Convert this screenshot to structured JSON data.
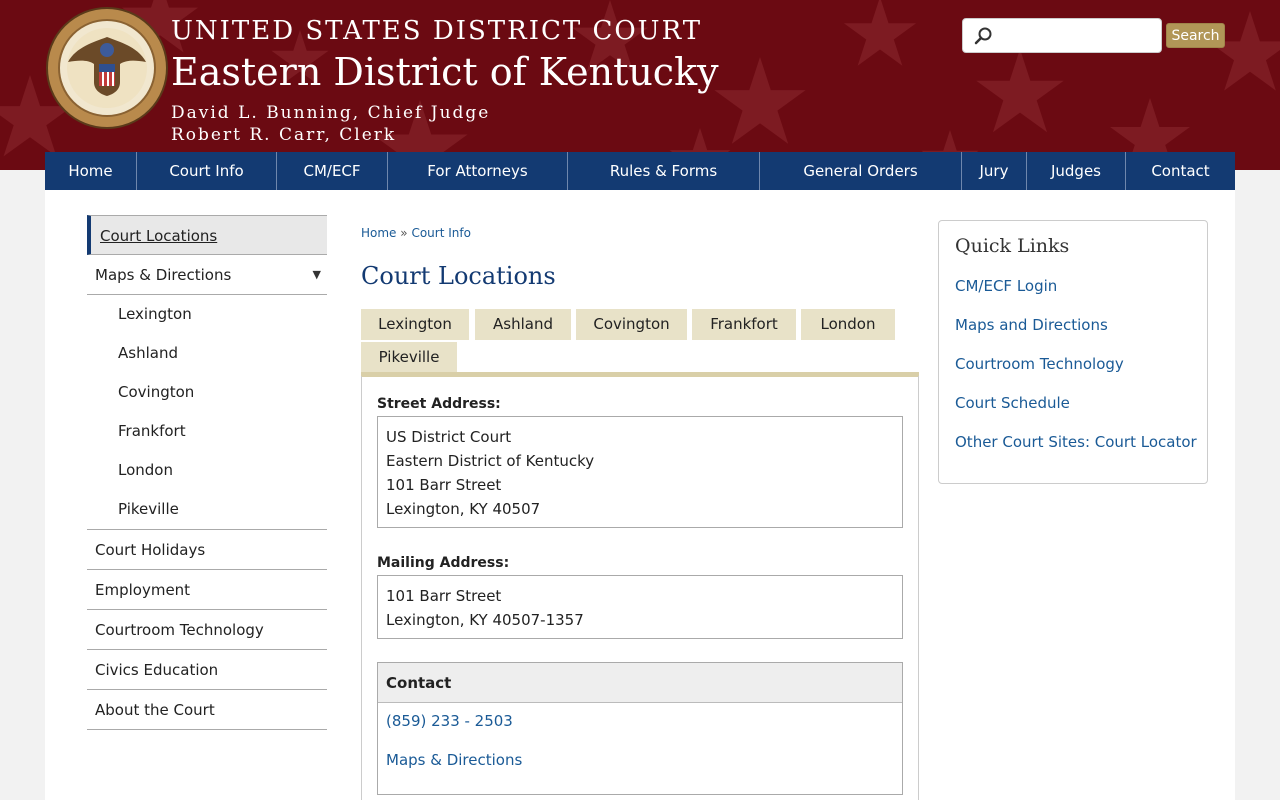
{
  "header": {
    "title_line1": "UNITED STATES DISTRICT COURT",
    "title_line2": "Eastern District of Kentucky",
    "judge": "David L. Bunning, Chief Judge",
    "clerk": "Robert R. Carr, Clerk",
    "seal_icon": "court-seal-icon"
  },
  "search": {
    "placeholder": "",
    "value": "",
    "button_label": "Search",
    "icon": "search-icon"
  },
  "nav": {
    "items": [
      "Home",
      "Court Info",
      "CM/ECF",
      "For Attorneys",
      "Rules & Forms",
      "General Orders",
      "Jury",
      "Judges",
      "Contact"
    ]
  },
  "sidebar": {
    "active": "Court Locations",
    "maps": "Maps & Directions",
    "sub_items": [
      "Lexington",
      "Ashland",
      "Covington",
      "Frankfort",
      "London",
      "Pikeville"
    ],
    "items": [
      "Court Holidays",
      "Employment",
      "Courtroom Technology",
      "Civics Education",
      "About the Court"
    ]
  },
  "breadcrumb": {
    "home": "Home",
    "separator": "»",
    "court_info": "Court Info"
  },
  "page_title": "Court Locations",
  "tabs": [
    "Lexington",
    "Ashland",
    "Covington",
    "Frankfort",
    "London",
    "Pikeville"
  ],
  "location": {
    "street_label": "Street Address:",
    "street_lines": [
      "US District Court",
      "Eastern District of Kentucky",
      "101 Barr Street",
      "Lexington, KY 40507"
    ],
    "mailing_label": "Mailing Address:",
    "mailing_lines": [
      "101 Barr Street",
      "Lexington, KY 40507-1357"
    ],
    "contact_heading": "Contact",
    "phone": "(859) 233 - 2503",
    "maps_link": "Maps & Directions"
  },
  "quick_links": {
    "title": "Quick Links",
    "items": [
      "CM/ECF Login",
      "Maps and Directions",
      "Courtroom Technology",
      "Court Schedule",
      "Other Court Sites: Court Locator"
    ]
  },
  "colors": {
    "header_bg": "#6b0a12",
    "nav_bg": "#133a72",
    "link": "#1a5a96",
    "tab_bg": "#e8e2c8",
    "search_button": "#b19657"
  }
}
